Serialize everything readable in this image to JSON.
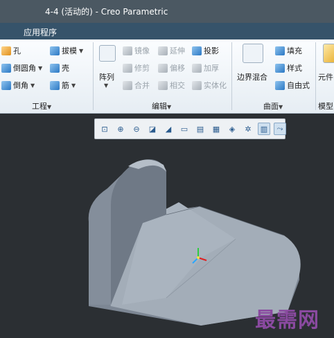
{
  "window": {
    "title": "4-4 (活动的) - Creo Parametric"
  },
  "menubar": {
    "item": "应用程序"
  },
  "ribbon": {
    "engineering": {
      "hole": "孔",
      "draft": "拔模",
      "round": "倒圆角",
      "shell": "壳",
      "chamfer": "倒角",
      "rib": "筋",
      "label": "工程"
    },
    "editing": {
      "pattern": "阵列",
      "mirror": "镜像",
      "extend": "延伸",
      "project": "投影",
      "trim": "修剪",
      "offset": "偏移",
      "thicken": "加厚",
      "merge": "合并",
      "intersect": "相交",
      "solidify": "实体化",
      "label": "编辑"
    },
    "surfaces": {
      "boundary_blend": "边界混合",
      "fill": "填充",
      "style": "样式",
      "freestyle": "自由式",
      "label": "曲面"
    },
    "model_intent": {
      "component": "元件",
      "label": "模型"
    }
  },
  "view_toolbar": {
    "icons": [
      "refit-icon",
      "zoom-in-icon",
      "zoom-out-icon",
      "repaint-icon",
      "display-style-icon",
      "saved-orientation-icon",
      "named-views-icon",
      "view-manager-icon",
      "datum-display-icon",
      "spin-center-icon",
      "annotation-display-icon",
      "transparency-icon"
    ]
  },
  "watermark": {
    "text": "最需网"
  },
  "colors": {
    "titlebar": "#4b5862",
    "menubar": "#36536a",
    "viewport_bg": "#2b2f33",
    "model_face": "#9aa4b0",
    "watermark": "#8a4aa0"
  }
}
